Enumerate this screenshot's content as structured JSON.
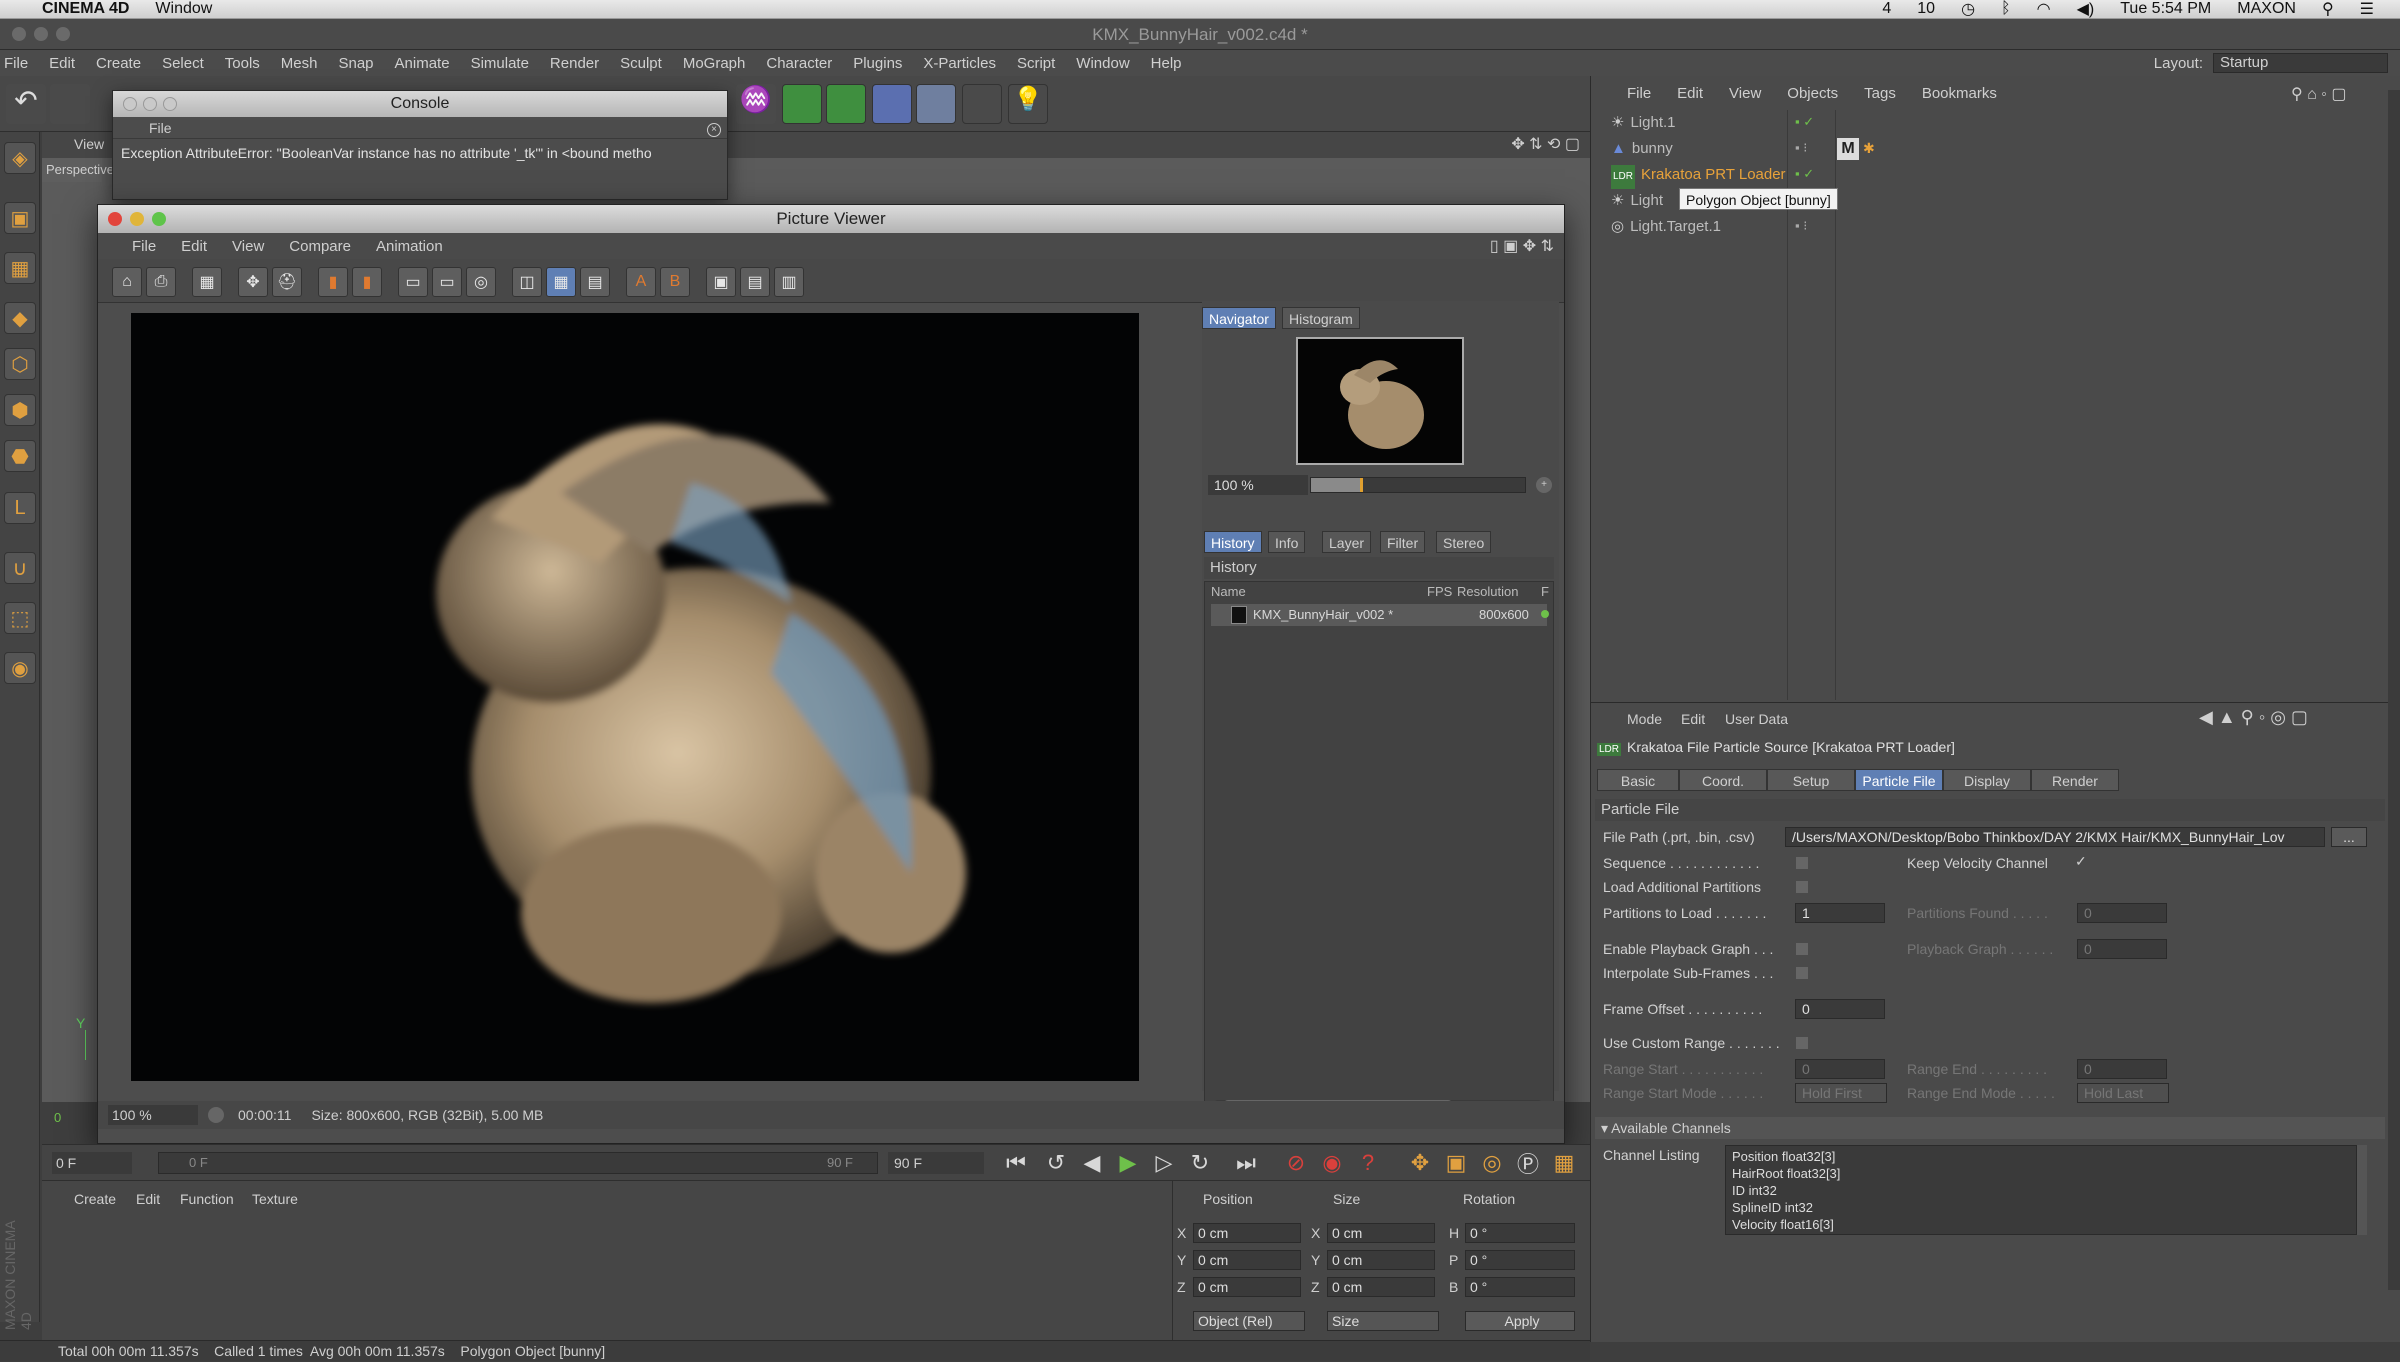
{
  "system_menu": {
    "apple_icon": "apple-icon",
    "app_name": "CINEMA 4D",
    "window_menu": "Window",
    "status_right": {
      "adobe_count": "4",
      "cloud_count": "10",
      "time": "Tue 5:54 PM",
      "user": "MAXON"
    }
  },
  "app": {
    "title": "KMX_BunnyHair_v002.c4d *",
    "menu": [
      "File",
      "Edit",
      "Create",
      "Select",
      "Tools",
      "Mesh",
      "Snap",
      "Animate",
      "Simulate",
      "Render",
      "Sculpt",
      "MoGraph",
      "Character",
      "Plugins",
      "X-Particles",
      "Script",
      "Window",
      "Help"
    ],
    "layout_label": "Layout:",
    "layout_value": "Startup"
  },
  "viewport": {
    "menu_view": "View",
    "camera_label": "Perspective"
  },
  "console": {
    "title": "Console",
    "menu_file": "File",
    "message": "Exception AttributeError: \"BooleanVar instance has no attribute '_tk'\" in <bound metho"
  },
  "picture_viewer": {
    "title": "Picture Viewer",
    "menu": [
      "File",
      "Edit",
      "View",
      "Compare",
      "Animation"
    ],
    "nav_tabs": [
      "Navigator",
      "Histogram"
    ],
    "zoom": "100 %",
    "info_tabs": [
      "History",
      "Info",
      "Layer",
      "Filter",
      "Stereo"
    ],
    "history_heading": "History",
    "history_cols": [
      "Name",
      "FPS",
      "Resolution",
      "F"
    ],
    "history_row": {
      "name": "KMX_BunnyHair_v002 *",
      "resolution": "800x600"
    },
    "status_zoom": "100 %",
    "status_time": "00:00:11",
    "status_size": "Size: 800x600, RGB (32Bit), 5.00 MB"
  },
  "timeline": {
    "frame_start": "0 F",
    "frame_cur": "0 F",
    "frame_end_a": "90 F",
    "frame_end_b": "90 F",
    "marker": "0"
  },
  "material_manager": {
    "menu": [
      "Create",
      "Edit",
      "Function",
      "Texture"
    ]
  },
  "coordinates": {
    "headers": [
      "Position",
      "Size",
      "Rotation"
    ],
    "rows": [
      {
        "axis": "X",
        "pos": "0 cm",
        "saxis": "X",
        "size": "0 cm",
        "raxis": "H",
        "rot": "0 °"
      },
      {
        "axis": "Y",
        "pos": "0 cm",
        "saxis": "Y",
        "size": "0 cm",
        "raxis": "P",
        "rot": "0 °"
      },
      {
        "axis": "Z",
        "pos": "0 cm",
        "saxis": "Z",
        "size": "0 cm",
        "raxis": "B",
        "rot": "0 °"
      }
    ],
    "mode_select": "Object (Rel)",
    "size_select": "Size",
    "apply": "Apply"
  },
  "status_bar": {
    "text": "Total 00h 00m 11.357s    Called 1 times  Avg 00h 00m 11.357s    Polygon Object [bunny]"
  },
  "object_manager": {
    "menu": [
      "File",
      "Edit",
      "View",
      "Objects",
      "Tags",
      "Bookmarks"
    ],
    "objects": [
      "Light.1",
      "bunny",
      "Krakatoa PRT Loader",
      "Light",
      "Light.Target.1"
    ],
    "tooltip": "Polygon Object [bunny]",
    "material_tag": "M"
  },
  "attributes": {
    "menu": [
      "Mode",
      "Edit",
      "User Data"
    ],
    "object_title": "Krakatoa File Particle Source [Krakatoa PRT Loader]",
    "tabs": [
      "Basic",
      "Coord.",
      "Setup",
      "Particle File",
      "Display",
      "Render"
    ],
    "active_tab": "Particle File",
    "section": "Particle File",
    "file_path_label": "File Path (.prt, .bin, .csv)",
    "file_path_value": "/Users/MAXON/Desktop/Bobo Thinkbox/DAY 2/KMX Hair/KMX_BunnyHair_Lov",
    "browse": "...",
    "sequence": "Sequence . . . . . . . . . . . .",
    "keep_velocity": "Keep Velocity Channel",
    "load_additional": "Load Additional Partitions",
    "partitions_to_load": "Partitions to Load . . . . . . .",
    "partitions_to_load_val": "1",
    "partitions_found": "Partitions Found . . . . .",
    "partitions_found_val": "0",
    "enable_playback": "Enable Playback Graph . . .",
    "playback_graph": "Playback Graph . . . . . .",
    "playback_graph_val": "0",
    "interpolate": "Interpolate Sub-Frames . . .",
    "frame_offset": "Frame Offset . . . . . . . . . .",
    "frame_offset_val": "0",
    "use_custom_range": "Use Custom Range . . . . . . .",
    "range_start": "Range Start . . . . . . . . . . .",
    "range_start_val": "0",
    "range_end": "Range End . . . . . . . . .",
    "range_end_val": "0",
    "range_start_mode": "Range Start Mode . . . . . .",
    "range_start_mode_val": "Hold First",
    "range_end_mode": "Range End Mode . . . . .",
    "range_end_mode_val": "Hold Last",
    "available_channels": "Available Channels",
    "channel_listing": "Channel Listing",
    "channels": [
      "Position float32[3]",
      "HairRoot float32[3]",
      "ID int32",
      "SplineID int32",
      "Velocity float16[3]"
    ]
  },
  "colors": {
    "accent": "#5f7fb4",
    "object_orange": "#e8a23a",
    "check_green": "#6ec04a"
  }
}
